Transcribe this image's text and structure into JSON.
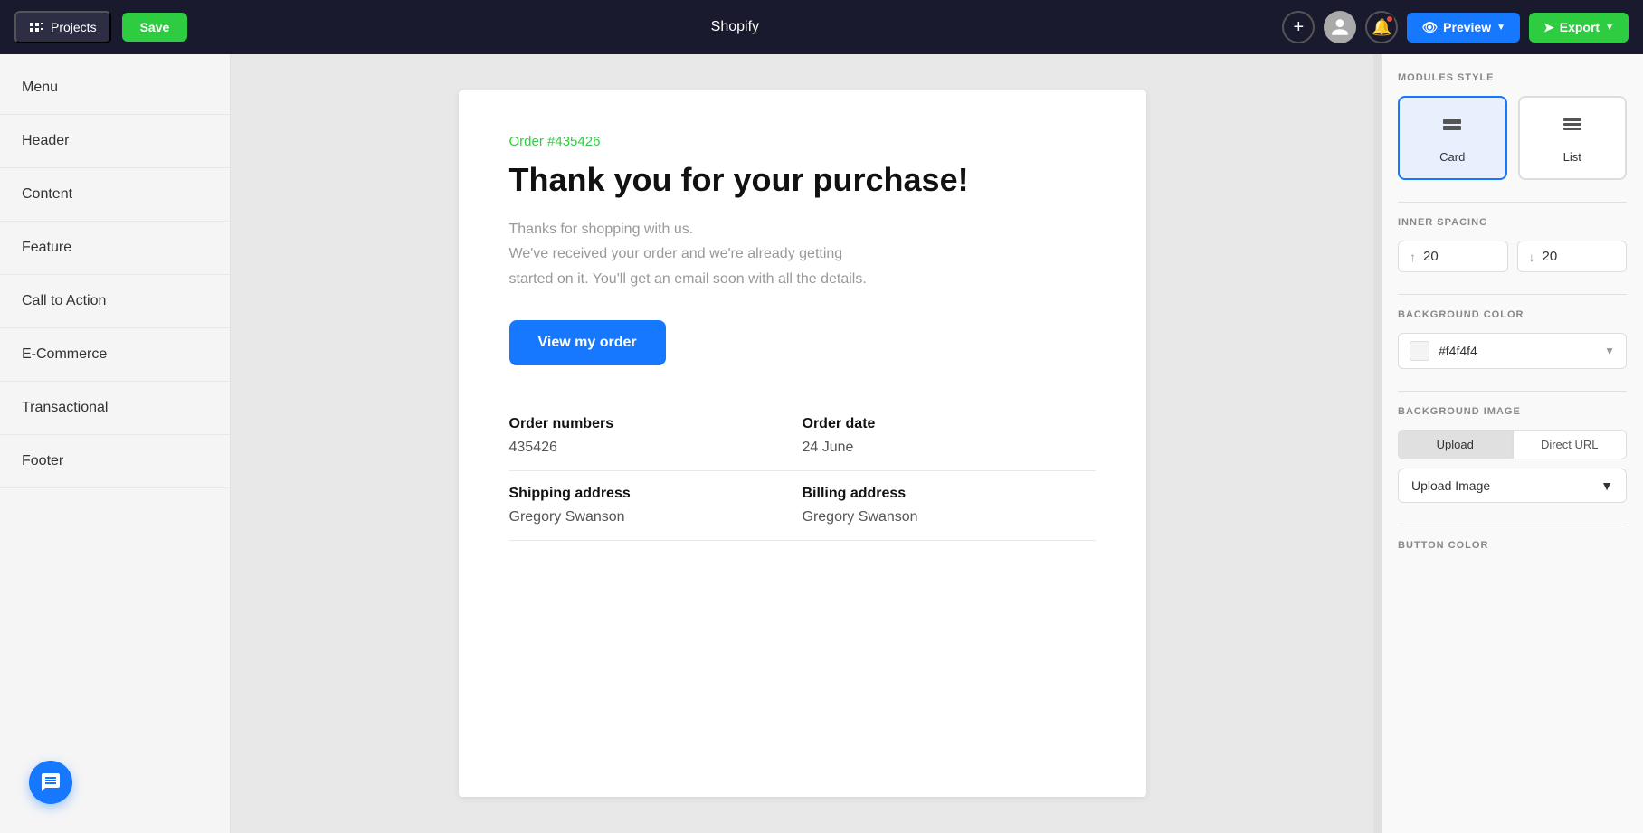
{
  "topbar": {
    "projects_label": "Projects",
    "save_label": "Save",
    "title": "Shopify",
    "preview_label": "Preview",
    "export_label": "Export"
  },
  "sidebar": {
    "items": [
      {
        "label": "Menu"
      },
      {
        "label": "Header"
      },
      {
        "label": "Content"
      },
      {
        "label": "Feature"
      },
      {
        "label": "Call to Action"
      },
      {
        "label": "E-Commerce"
      },
      {
        "label": "Transactional"
      },
      {
        "label": "Footer"
      }
    ]
  },
  "email": {
    "order_label": "Order #435426",
    "title": "Thank you for your purchase!",
    "description_line1": "Thanks for shopping with us.",
    "description_line2": "We've received your order and we're already getting",
    "description_line3": "started on it. You'll get an email soon with all the details.",
    "cta_button": "View my order",
    "fields": [
      {
        "label": "Order numbers",
        "value": "435426"
      },
      {
        "label": "Order date",
        "value": "24 June"
      },
      {
        "label": "Shipping address",
        "value": "Gregory Swanson"
      },
      {
        "label": "Billing address",
        "value": "Gregory Swanson"
      }
    ]
  },
  "right_panel": {
    "modules_style_title": "MODULES STYLE",
    "module_options": [
      {
        "label": "Card",
        "active": true
      },
      {
        "label": "List",
        "active": false
      }
    ],
    "inner_spacing_title": "INNER SPACING",
    "inner_spacing_top": "20",
    "inner_spacing_bottom": "20",
    "bg_color_title": "BACKGROUND COLOR",
    "bg_color_hex": "#f4f4f4",
    "bg_image_title": "BACKGROUND IMAGE",
    "upload_tab_label": "Upload",
    "direct_url_tab_label": "Direct URL",
    "upload_image_label": "Upload Image",
    "button_color_title": "BUTTON COLOR"
  }
}
